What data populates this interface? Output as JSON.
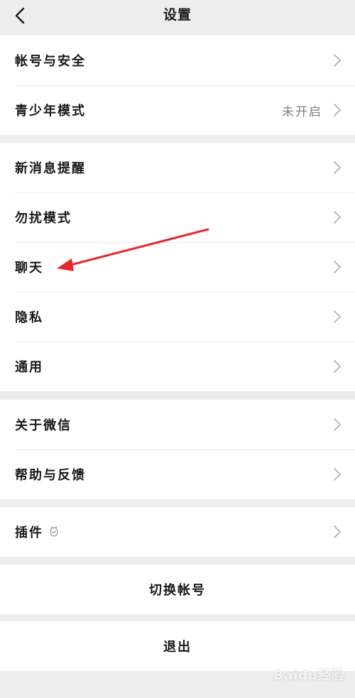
{
  "header": {
    "title": "设置",
    "back_icon": "chevron-left-icon"
  },
  "groups": [
    {
      "rows": [
        {
          "label": "帐号与安全"
        },
        {
          "label": "青少年模式",
          "value": "未开启"
        }
      ]
    },
    {
      "rows": [
        {
          "label": "新消息提醒"
        },
        {
          "label": "勿扰模式"
        },
        {
          "label": "聊天"
        },
        {
          "label": "隐私"
        },
        {
          "label": "通用"
        }
      ]
    },
    {
      "rows": [
        {
          "label": "关于微信"
        },
        {
          "label": "帮助与反馈"
        }
      ]
    },
    {
      "rows": [
        {
          "label": "插件",
          "badge_icon": "plugin-badge-icon"
        }
      ]
    }
  ],
  "actions": {
    "switch_account": "切换帐号",
    "logout": "退出"
  },
  "annotation": {
    "color": "#e8262b"
  },
  "watermark": {
    "text": "Baidu经验"
  },
  "colors": {
    "background": "#ededed",
    "row": "#ffffff",
    "chevron": "#b2b2b2",
    "value_text": "#808080"
  }
}
